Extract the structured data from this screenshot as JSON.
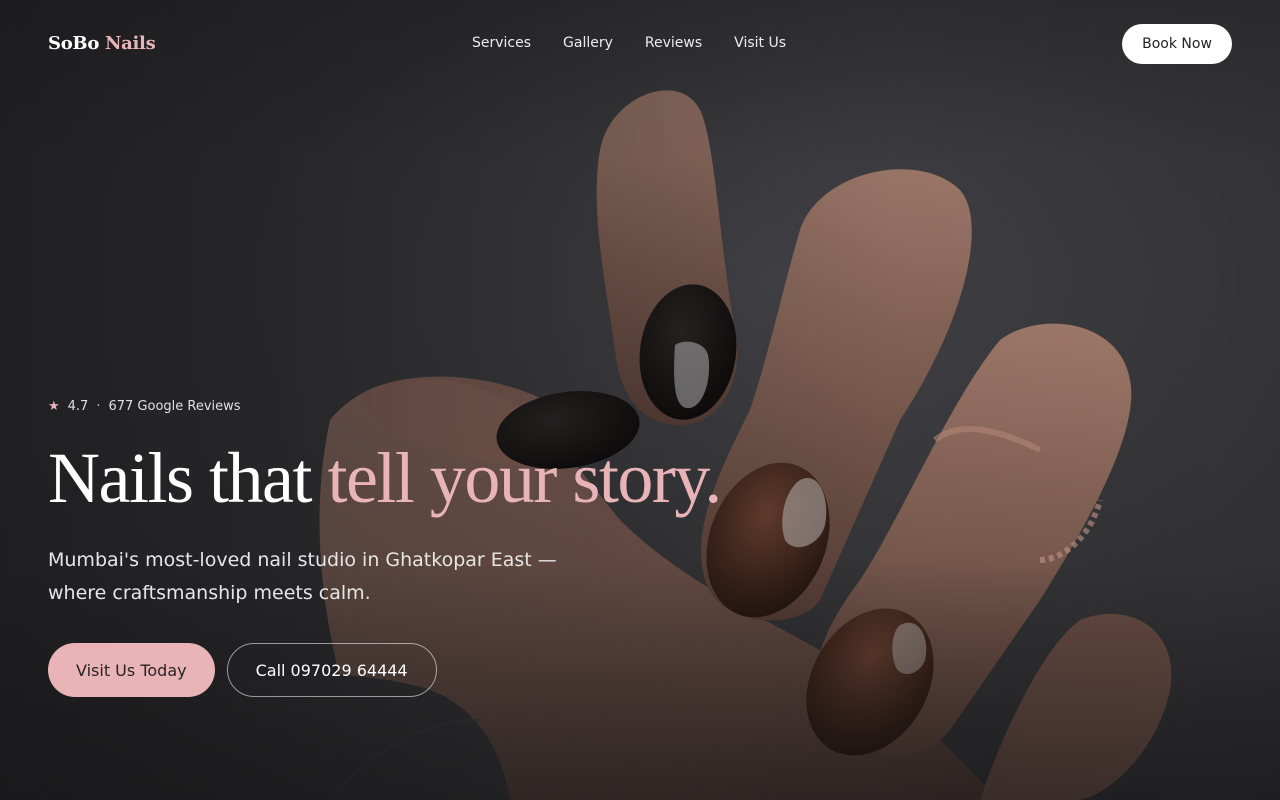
{
  "brand": {
    "name_part1": "SoBo",
    "name_part2": "Nails",
    "accent_color": "#e8b4b8"
  },
  "nav": {
    "links": [
      "Services",
      "Gallery",
      "Reviews",
      "Visit Us"
    ],
    "cta_label": "Book Now"
  },
  "hero": {
    "rating_icon": "star-icon",
    "rating_value": "4.7",
    "rating_separator": "·",
    "reviews_text": "677 Google Reviews",
    "headline_plain": "Nails that ",
    "headline_accent": "tell your story.",
    "subtitle": "Mumbai's most-loved nail studio in Ghatkopar East — where craftsmanship meets calm.",
    "primary_cta": "Visit Us Today",
    "secondary_cta": "Call 097029 64444",
    "background_image": "close-up of hand with black and brown glossy nails on dark background"
  }
}
